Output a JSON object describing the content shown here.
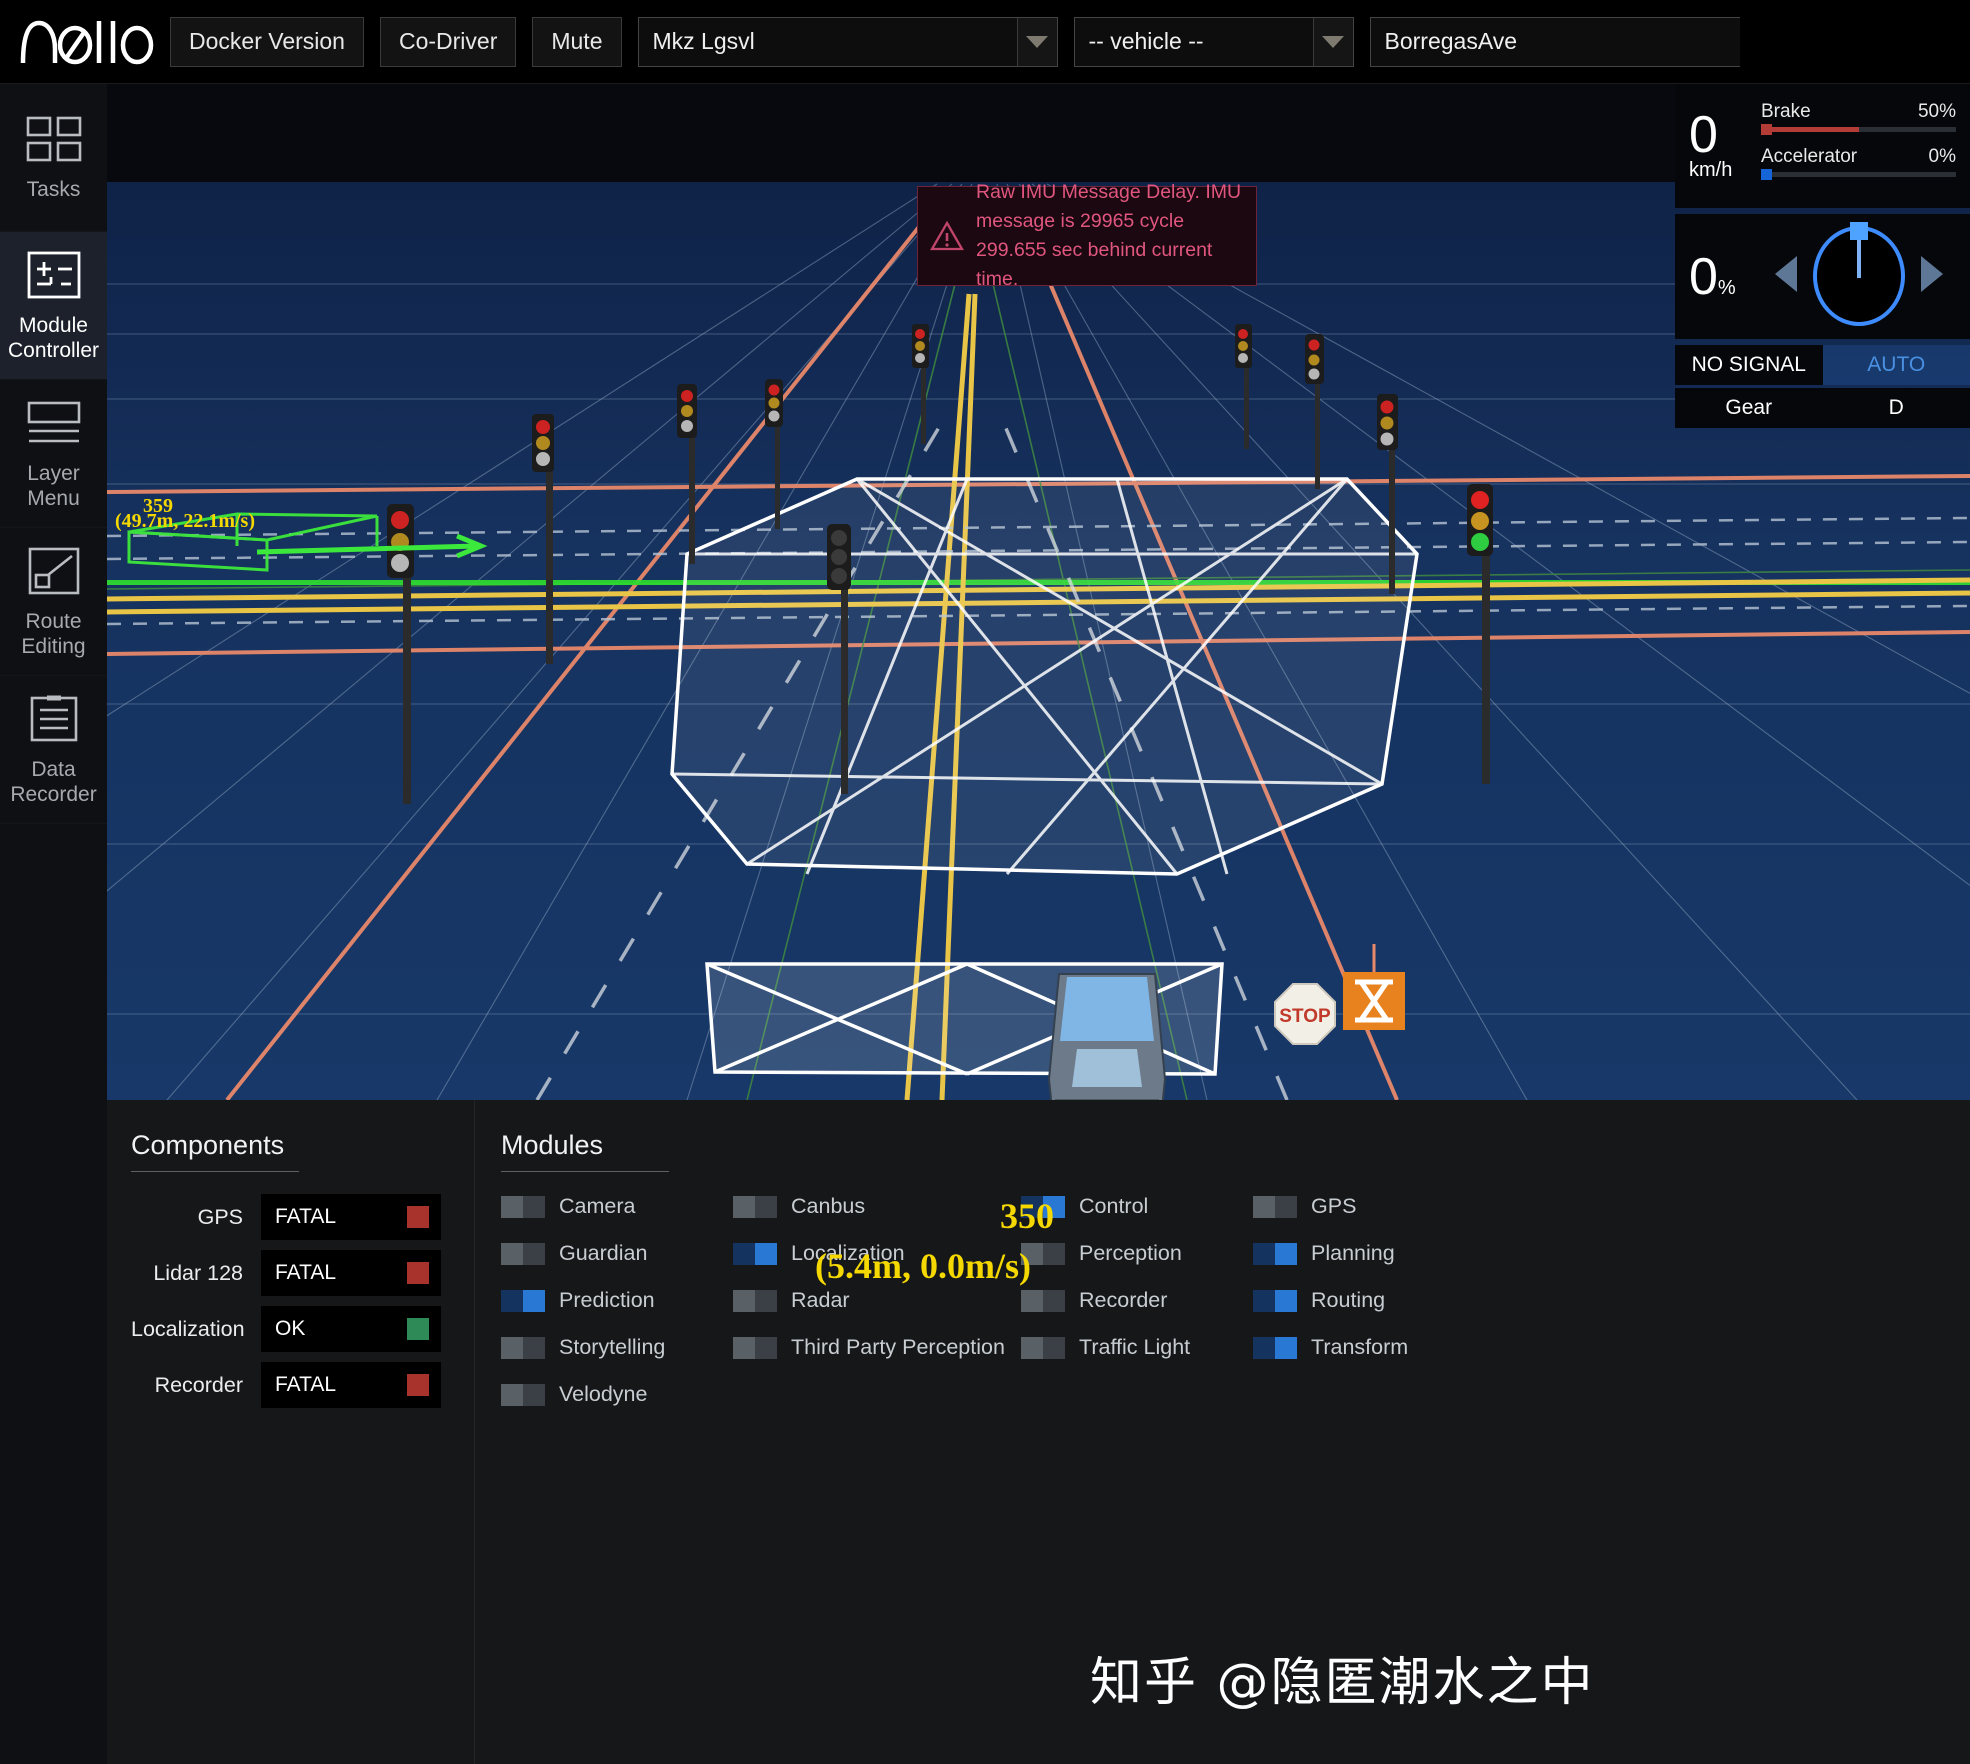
{
  "header": {
    "logo_text": "apollo",
    "buttons": [
      {
        "label": "Docker Version",
        "name": "docker-version-button"
      },
      {
        "label": "Co-Driver",
        "name": "co-driver-button"
      },
      {
        "label": "Mute",
        "name": "mute-button"
      }
    ],
    "selects": [
      {
        "name": "map-select",
        "value": "Mkz Lgsvl"
      },
      {
        "name": "vehicle-select",
        "value": "-- vehicle --"
      },
      {
        "name": "scenario-select",
        "value": "BorregasAve"
      }
    ]
  },
  "sidebar": {
    "items": [
      {
        "label": "Tasks",
        "icon": "grid-icon",
        "active": false
      },
      {
        "label": "Module Controller",
        "icon": "module-controller-icon",
        "active": true
      },
      {
        "label": "Layer Menu",
        "icon": "layers-icon",
        "active": false
      },
      {
        "label": "Route Editing",
        "icon": "route-icon",
        "active": false
      },
      {
        "label": "Data Recorder",
        "icon": "document-icon",
        "active": false
      }
    ]
  },
  "warning": {
    "icon": "warning-triangle-icon",
    "message": "Raw IMU Message Delay. IMU message is 29965 cycle 299.655 sec behind current time."
  },
  "gauges": {
    "speed": {
      "value": "0",
      "unit": "km/h"
    },
    "brake": {
      "label": "Brake",
      "percent_text": "50%",
      "percent": 50,
      "color": "#b33c36"
    },
    "accelerator": {
      "label": "Accelerator",
      "percent_text": "0%",
      "percent": 0,
      "color": "#1565d8"
    },
    "steering": {
      "value": "0",
      "unit": "%",
      "angle_deg": 0,
      "color": "#3d8bfd"
    },
    "signal": {
      "left": "NO SIGNAL",
      "right": "AUTO",
      "right_color": "#4a90e2"
    },
    "gear": {
      "label": "Gear",
      "value": "D"
    }
  },
  "overlay": {
    "obstacle_main": {
      "id": "350",
      "info": "(5.4m, 0.0m/s)",
      "color": "#f5d800"
    },
    "obstacle_side": {
      "id": "359",
      "info": "(49.7m, 22.1m/s)",
      "color": "#f5d800"
    },
    "stop_sign_text": "STOP",
    "hourglass_icon": "hourglass-icon"
  },
  "components": {
    "title": "Components",
    "rows": [
      {
        "name": "GPS",
        "status": "FATAL",
        "color": "#a8332c"
      },
      {
        "name": "Lidar 128",
        "status": "FATAL",
        "color": "#a8332c"
      },
      {
        "name": "Localization",
        "status": "OK",
        "color": "#2e8b57"
      },
      {
        "name": "Recorder",
        "status": "FATAL",
        "color": "#a8332c"
      }
    ]
  },
  "modules": {
    "title": "Modules",
    "items": [
      {
        "label": "Camera",
        "on": false
      },
      {
        "label": "Canbus",
        "on": false
      },
      {
        "label": "Control",
        "on": true
      },
      {
        "label": "GPS",
        "on": false
      },
      {
        "label": "Guardian",
        "on": false
      },
      {
        "label": "Localization",
        "on": true
      },
      {
        "label": "Perception",
        "on": false
      },
      {
        "label": "Planning",
        "on": true
      },
      {
        "label": "Prediction",
        "on": true
      },
      {
        "label": "Radar",
        "on": false
      },
      {
        "label": "Recorder",
        "on": false
      },
      {
        "label": "Routing",
        "on": true
      },
      {
        "label": "Storytelling",
        "on": false
      },
      {
        "label": "Third Party Perception",
        "on": false
      },
      {
        "label": "Traffic Light",
        "on": false
      },
      {
        "label": "Transform",
        "on": true
      },
      {
        "label": "Velodyne",
        "on": false
      }
    ]
  },
  "watermark": {
    "text": "知乎 @隐匿潮水之中"
  },
  "colors": {
    "accent_blue": "#1565d8",
    "warning_red": "#e0567f",
    "status_ok": "#2e8b57",
    "status_fatal": "#a8332c",
    "road_bg": "#15305c"
  }
}
